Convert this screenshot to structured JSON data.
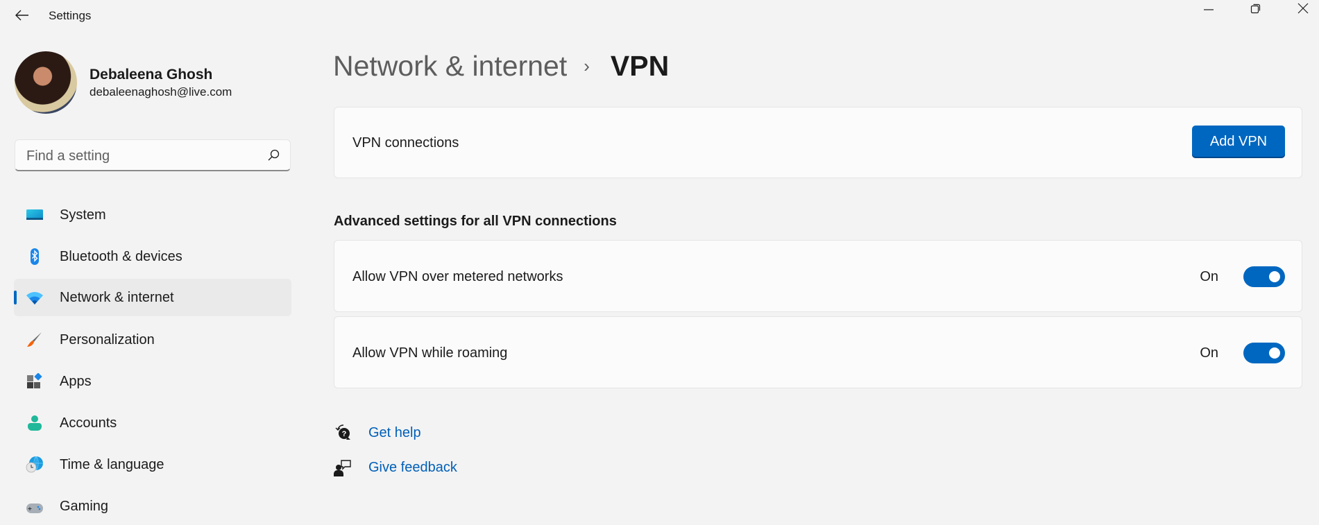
{
  "window": {
    "title": "Settings",
    "controls": [
      "minimize",
      "restore",
      "close"
    ]
  },
  "profile": {
    "name": "Debaleena Ghosh",
    "email": "debaleenaghosh@live.com"
  },
  "search": {
    "placeholder": "Find a setting",
    "value": ""
  },
  "sidebar": {
    "items": [
      {
        "label": "System",
        "icon": "system-icon",
        "selected": false
      },
      {
        "label": "Bluetooth & devices",
        "icon": "bluetooth-icon",
        "selected": false
      },
      {
        "label": "Network & internet",
        "icon": "wifi-icon",
        "selected": true
      },
      {
        "label": "Personalization",
        "icon": "brush-icon",
        "selected": false
      },
      {
        "label": "Apps",
        "icon": "apps-icon",
        "selected": false
      },
      {
        "label": "Accounts",
        "icon": "account-icon",
        "selected": false
      },
      {
        "label": "Time & language",
        "icon": "globe-clock-icon",
        "selected": false
      },
      {
        "label": "Gaming",
        "icon": "gamepad-icon",
        "selected": false
      }
    ]
  },
  "header": {
    "parent": "Network & internet",
    "separator": "›",
    "current": "VPN"
  },
  "vpn_connections": {
    "label": "VPN connections",
    "button_label": "Add VPN"
  },
  "advanced": {
    "title": "Advanced settings for all VPN connections",
    "settings": [
      {
        "label": "Allow VPN over metered networks",
        "state_label": "On",
        "on": true
      },
      {
        "label": "Allow VPN while roaming",
        "state_label": "On",
        "on": true
      }
    ]
  },
  "links": {
    "get_help": "Get help",
    "give_feedback": "Give feedback"
  },
  "colors": {
    "accent": "#0067c0",
    "link": "#005fb8",
    "background": "#f3f3f3",
    "card": "#fbfbfb"
  }
}
